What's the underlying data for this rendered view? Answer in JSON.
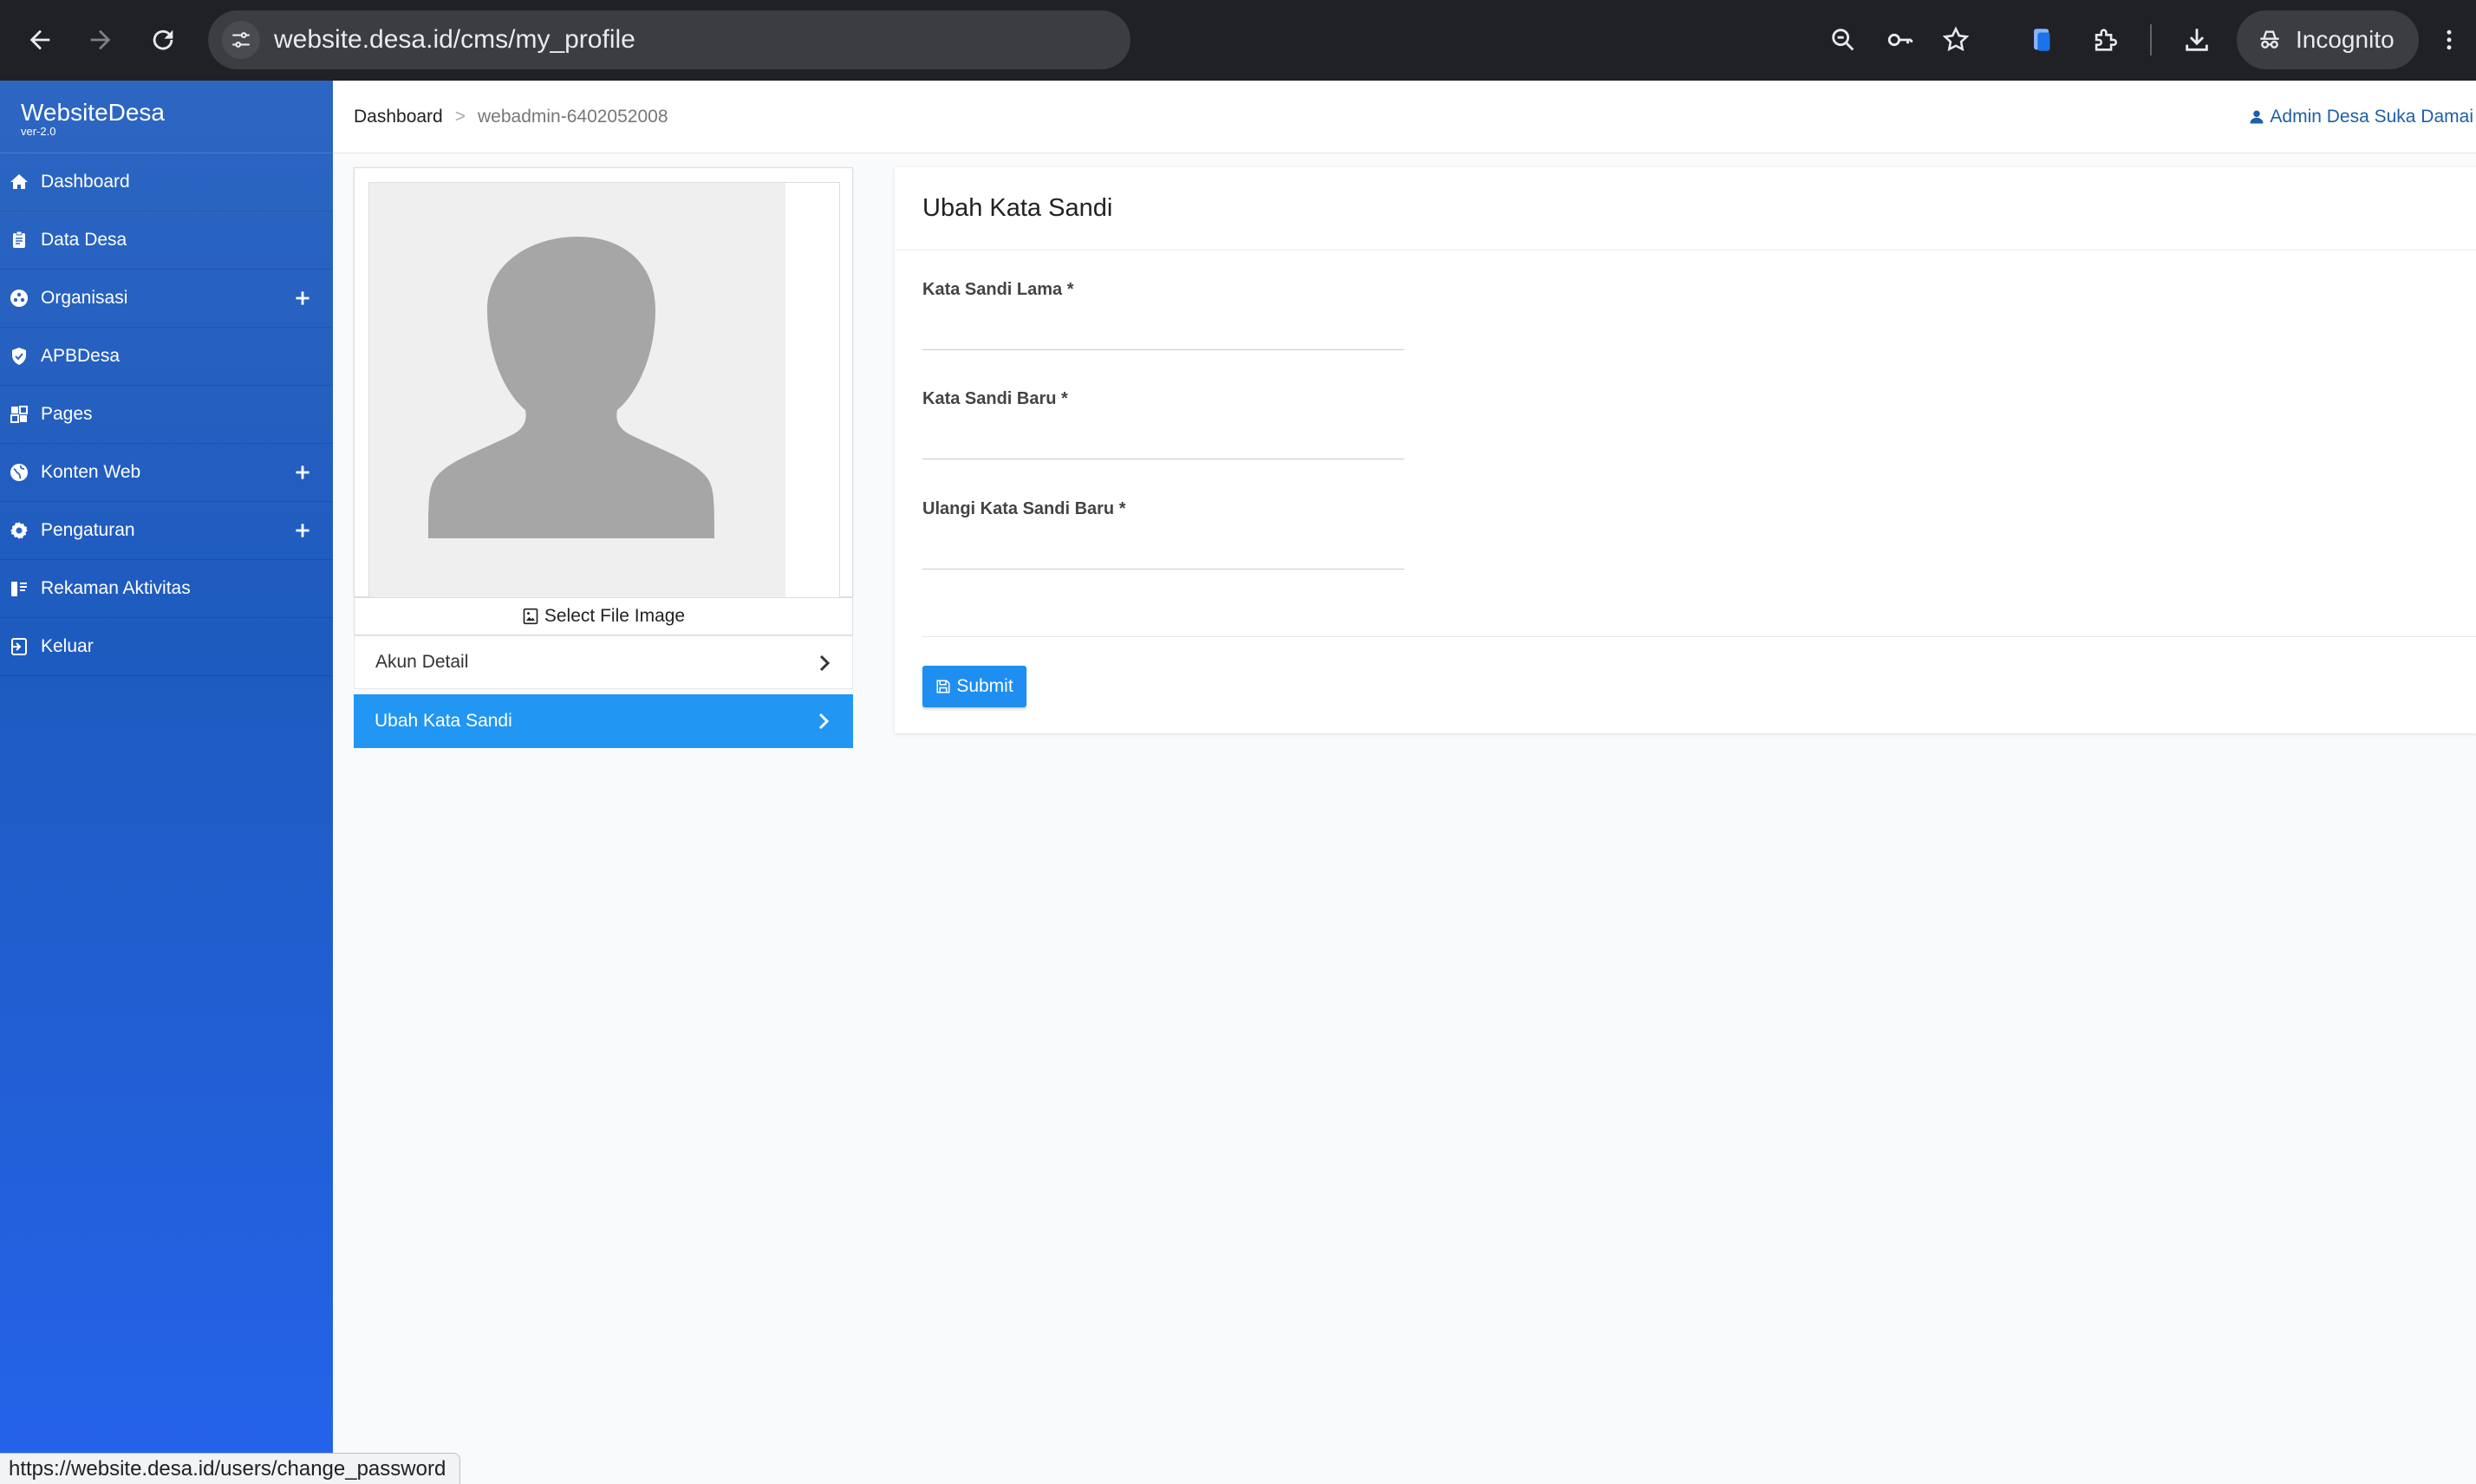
{
  "browser": {
    "url": "website.desa.id/cms/my_profile",
    "incognito_label": "Incognito"
  },
  "brand": {
    "name": "WebsiteDesa",
    "version": "ver-2.0"
  },
  "sidebar": {
    "items": [
      {
        "label": "Dashboard",
        "icon": "home-icon",
        "expandable": false
      },
      {
        "label": "Data Desa",
        "icon": "clipboard-icon",
        "expandable": false
      },
      {
        "label": "Organisasi",
        "icon": "users-circle-icon",
        "expandable": true
      },
      {
        "label": "APBDesa",
        "icon": "shield-check-icon",
        "expandable": false
      },
      {
        "label": "Pages",
        "icon": "pages-icon",
        "expandable": false
      },
      {
        "label": "Konten Web",
        "icon": "globe-icon",
        "expandable": true
      },
      {
        "label": "Pengaturan",
        "icon": "gear-icon",
        "expandable": true
      },
      {
        "label": "Rekaman Aktivitas",
        "icon": "activity-list-icon",
        "expandable": false
      },
      {
        "label": "Keluar",
        "icon": "logout-icon",
        "expandable": false
      }
    ]
  },
  "topbar": {
    "breadcrumb_home": "Dashboard",
    "breadcrumb_separator": ">",
    "breadcrumb_current": "webadmin-6402052008",
    "user_name": "Admin Desa Suka Damai"
  },
  "profile": {
    "select_file_label": "Select File Image",
    "menu": [
      {
        "label": "Akun Detail",
        "active": false
      },
      {
        "label": "Ubah Kata Sandi",
        "active": true
      }
    ]
  },
  "form": {
    "title": "Ubah Kata Sandi",
    "fields": [
      {
        "label": "Kata Sandi Lama *",
        "value": ""
      },
      {
        "label": "Kata Sandi Baru *",
        "value": ""
      },
      {
        "label": "Ulangi Kata Sandi Baru *",
        "value": ""
      }
    ],
    "submit_label": "Submit"
  },
  "status_bar": {
    "text": "https://website.desa.id/users/change_password"
  },
  "colors": {
    "sidebar": "#2d66c2",
    "accent": "#2296f3",
    "submit": "#1f8ef1",
    "link": "#1d5fa8"
  }
}
